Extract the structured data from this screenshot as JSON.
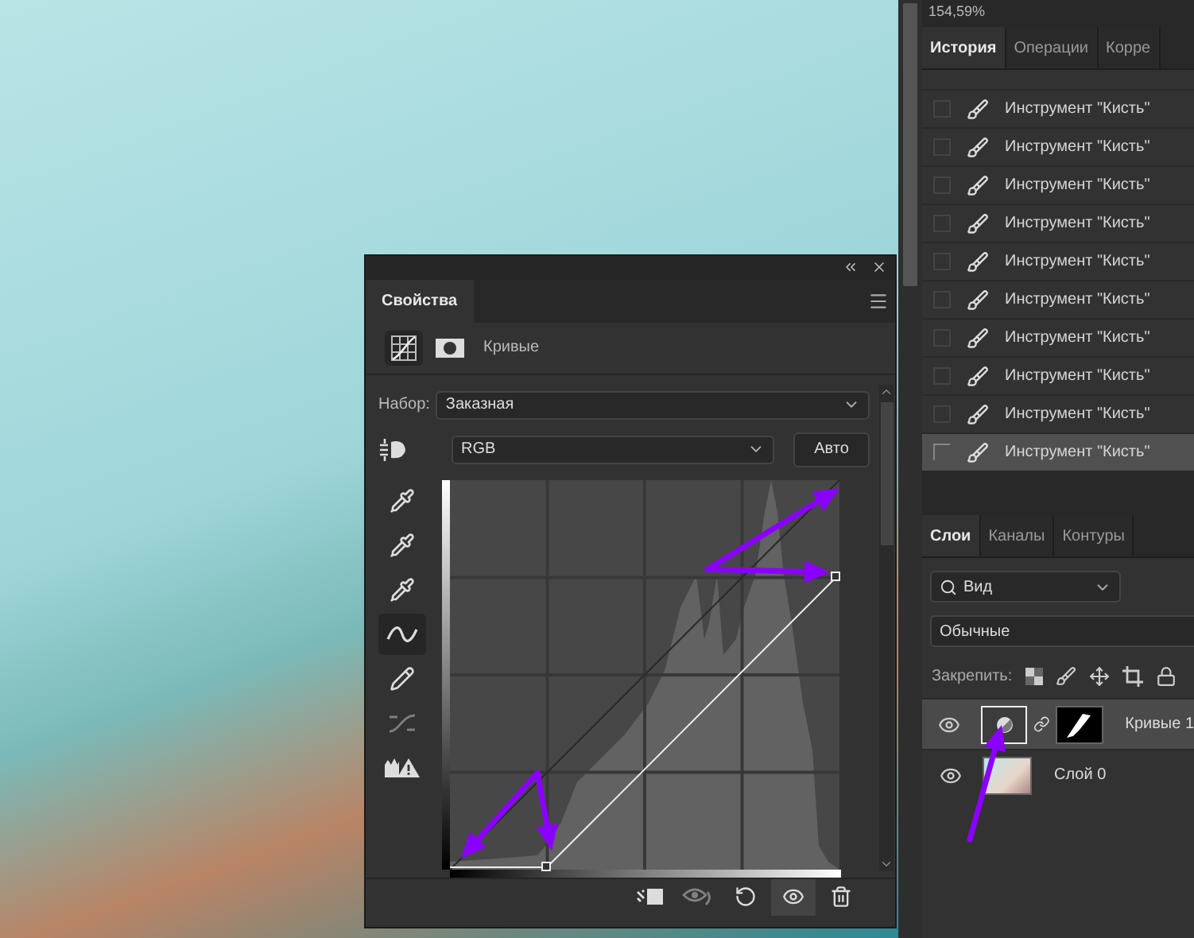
{
  "zoom": "154,59%",
  "history": {
    "tabs": [
      {
        "label": "История",
        "selected": true
      },
      {
        "label": "Операции",
        "selected": false
      },
      {
        "label": "Корре",
        "selected": false
      }
    ],
    "items": [
      {
        "label": "Инструмент \"Кисть\"",
        "selected": false
      },
      {
        "label": "Инструмент \"Кисть\"",
        "selected": false
      },
      {
        "label": "Инструмент \"Кисть\"",
        "selected": false
      },
      {
        "label": "Инструмент \"Кисть\"",
        "selected": false
      },
      {
        "label": "Инструмент \"Кисть\"",
        "selected": false
      },
      {
        "label": "Инструмент \"Кисть\"",
        "selected": false
      },
      {
        "label": "Инструмент \"Кисть\"",
        "selected": false
      },
      {
        "label": "Инструмент \"Кисть\"",
        "selected": false
      },
      {
        "label": "Инструмент \"Кисть\"",
        "selected": false
      },
      {
        "label": "Инструмент \"Кисть\"",
        "selected": true
      }
    ]
  },
  "properties": {
    "title": "Свойства",
    "adjustment": "Кривые",
    "preset_label": "Набор:",
    "preset": "Заказная",
    "channel": "RGB",
    "auto_button": "Авто",
    "tools": [
      {
        "kind": "eyedropper",
        "selected": false,
        "disabled": false
      },
      {
        "kind": "eyedropper",
        "selected": false,
        "disabled": false
      },
      {
        "kind": "eyedropper",
        "selected": false,
        "disabled": false
      },
      {
        "kind": "curve",
        "selected": true,
        "disabled": false
      },
      {
        "kind": "pencil",
        "selected": false,
        "disabled": false
      },
      {
        "kind": "smooth",
        "selected": false,
        "disabled": true
      },
      {
        "kind": "clipping",
        "selected": false,
        "disabled": false
      }
    ],
    "bottom_tools": [
      {
        "kind": "clip",
        "selected": false,
        "disabled": false
      },
      {
        "kind": "previous",
        "selected": false,
        "disabled": true
      },
      {
        "kind": "reset",
        "selected": false,
        "disabled": false
      },
      {
        "kind": "visibility",
        "selected": true,
        "disabled": false
      },
      {
        "kind": "delete",
        "selected": false,
        "disabled": false
      }
    ]
  },
  "layers": {
    "tabs": [
      {
        "label": "Слои",
        "selected": true
      },
      {
        "label": "Каналы",
        "selected": false
      },
      {
        "label": "Контуры",
        "selected": false
      }
    ],
    "filter": "Вид",
    "blend_mode": "Обычные",
    "lock_label": "Закрепить:",
    "items": [
      {
        "name": "Кривые 1",
        "kind": "adjustment",
        "selected": true,
        "visible": true
      },
      {
        "name": "Слой 0",
        "kind": "pixel",
        "selected": false,
        "visible": true
      }
    ]
  }
}
